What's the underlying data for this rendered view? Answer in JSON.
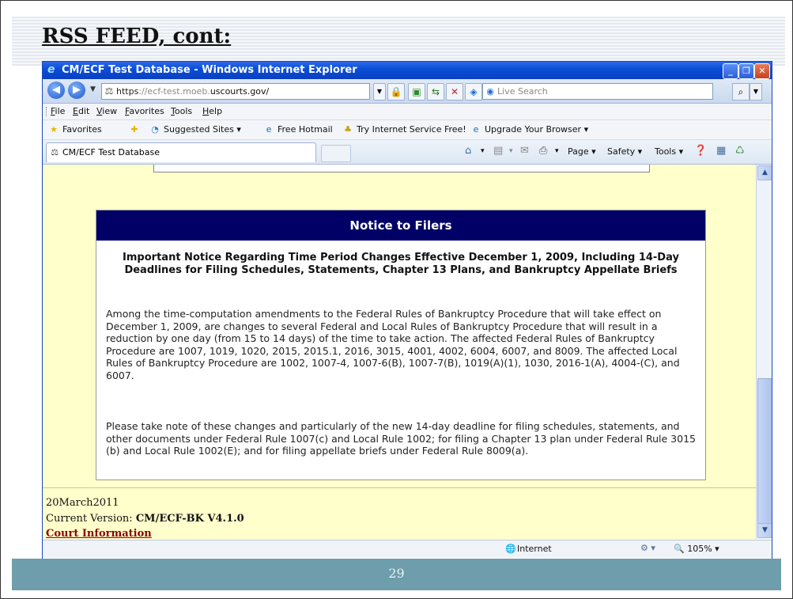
{
  "slide": {
    "title": "RSS FEED, cont:",
    "page_number": "29"
  },
  "window": {
    "title": "CM/ECF Test Database - Windows Internet Explorer",
    "icon": "ie-logo-icon",
    "controls": [
      "minimize",
      "restore",
      "close"
    ]
  },
  "address_bar": {
    "url_scheme": "https",
    "url_host": "://ecf-test.moeb.",
    "url_domain": "uscourts.gov/",
    "search_placeholder": "Live Search"
  },
  "menu": {
    "items": [
      "File",
      "Edit",
      "View",
      "Favorites",
      "Tools",
      "Help"
    ]
  },
  "favorites_bar": {
    "favorites_label": "Favorites",
    "items": [
      "Suggested Sites ▾",
      "Free Hotmail",
      "Try Internet Service Free!",
      "Upgrade Your Browser ▾"
    ]
  },
  "tab": {
    "label": "CM/ECF Test Database"
  },
  "command_bar": {
    "page": "Page ▾",
    "safety": "Safety ▾",
    "tools": "Tools ▾"
  },
  "notice": {
    "header": "Notice to Filers",
    "subtitle": "Important Notice Regarding Time Period Changes Effective December 1, 2009, Including 14-Day Deadlines for Filing Schedules, Statements, Chapter 13 Plans, and Bankruptcy Appellate Briefs",
    "paragraph1": "Among the time-computation amendments to the Federal Rules of Bankruptcy Procedure that will take effect on December 1, 2009, are changes to several Federal and Local Rules of Bankruptcy Procedure that will result in a reduction by one day (from 15 to 14 days) of the time to take action. The affected Federal Rules of Bankruptcy Procedure are 1007, 1019, 1020, 2015, 2015.1, 2016, 3015, 4001, 4002, 6004, 6007, and 8009. The affected Local Rules of Bankruptcy Procedure are 1002, 1007-4, 1007-6(B), 1007-7(B), 1019(A)(1), 1030, 2016-1(A), 4004-(C), and 6007.",
    "paragraph2": "Please take note of these changes and particularly of the new 14-day deadline for filing schedules, statements, and other documents under Federal Rule 1007(c) and Local Rule 1002; for filing a Chapter 13 plan under Federal Rule 3015 (b) and Local Rule 1002(E); and for filing appellate briefs under Federal Rule 8009(a)."
  },
  "footer": {
    "date": "20March2011",
    "version_label": "Current Version: ",
    "version_value": "CM/ECF-BK V4.1.0",
    "court_link": "Court Information"
  },
  "status_bar": {
    "zone": "Internet",
    "zoom": "105%"
  },
  "colors": {
    "content_bg": "#ffffcc",
    "notice_header_bg": "#000066",
    "court_link": "#8b0000",
    "slide_bar": "#6e9dab"
  }
}
